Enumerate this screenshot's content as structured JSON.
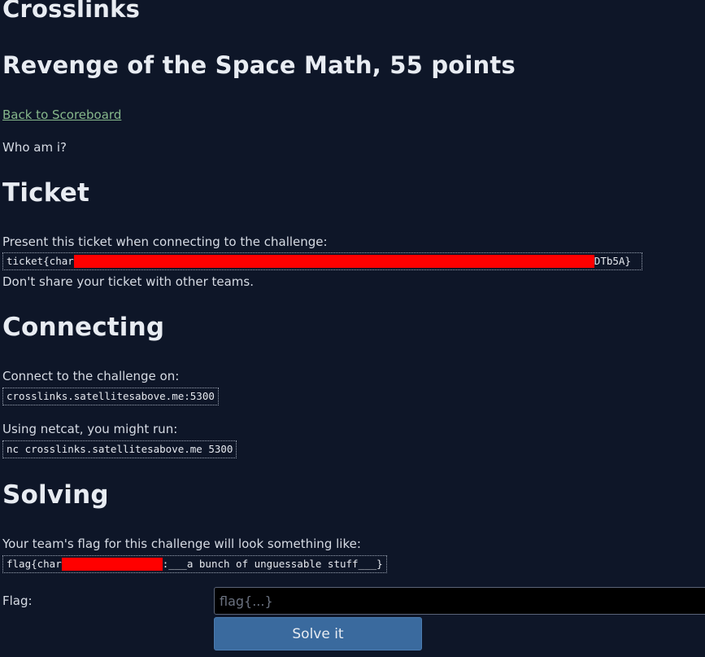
{
  "site": {
    "title": "Crosslinks"
  },
  "challenge": {
    "heading": "Revenge of the Space Math, 55 points",
    "back_link": "Back to Scoreboard",
    "description": "Who am i?"
  },
  "ticket": {
    "heading": "Ticket",
    "intro": "Present this ticket when connecting to the challenge:",
    "value_prefix": "ticket{char",
    "value_suffix": "DTb5A}",
    "warning": "Don't share your ticket with other teams."
  },
  "connecting": {
    "heading": "Connecting",
    "intro": "Connect to the challenge on:",
    "address": "crosslinks.satellitesabove.me:5300",
    "netcat_intro": "Using netcat, you might run:",
    "netcat_cmd": "nc crosslinks.satellitesabove.me 5300"
  },
  "solving": {
    "heading": "Solving",
    "intro": "Your team's flag for this challenge will look something like:",
    "flag_prefix": "flag{char",
    "flag_suffix": ":___a bunch of unguessable stuff___}",
    "flag_label": "Flag:",
    "flag_placeholder": "flag{...}",
    "submit_label": "Solve it"
  },
  "colors": {
    "background": "#0e1628",
    "link": "#86b88b",
    "redaction": "#ff0000",
    "button": "#3a6a9e"
  }
}
